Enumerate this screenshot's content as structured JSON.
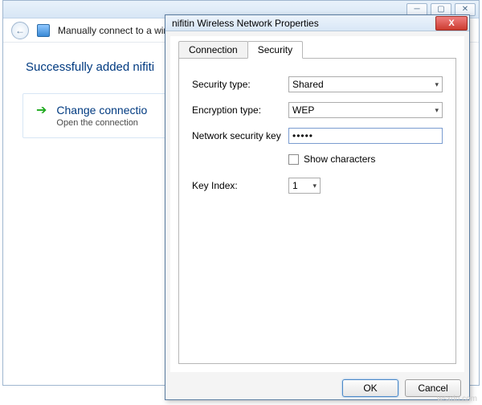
{
  "wizard": {
    "header_text": "Manually connect to a wirel",
    "success_text": "Successfully added nifiti",
    "option_title": "Change connectio",
    "option_sub": "Open the connection",
    "winbtn_min": "─",
    "winbtn_max": "▢",
    "winbtn_close": "✕",
    "back_arrow": "←"
  },
  "dialog": {
    "title": "nifitin Wireless Network Properties",
    "close_glyph": "X",
    "tabs": {
      "connection": "Connection",
      "security": "Security"
    },
    "labels": {
      "security_type": "Security type:",
      "encryption_type": "Encryption type:",
      "network_key": "Network security key",
      "show_chars": "Show characters",
      "key_index": "Key Index:"
    },
    "values": {
      "security_type": "Shared",
      "encryption_type": "WEP",
      "network_key_masked": "•••••",
      "key_index": "1"
    },
    "buttons": {
      "ok": "OK",
      "cancel": "Cancel"
    },
    "chevron": "▾"
  },
  "watermark": "wsxdn.com"
}
